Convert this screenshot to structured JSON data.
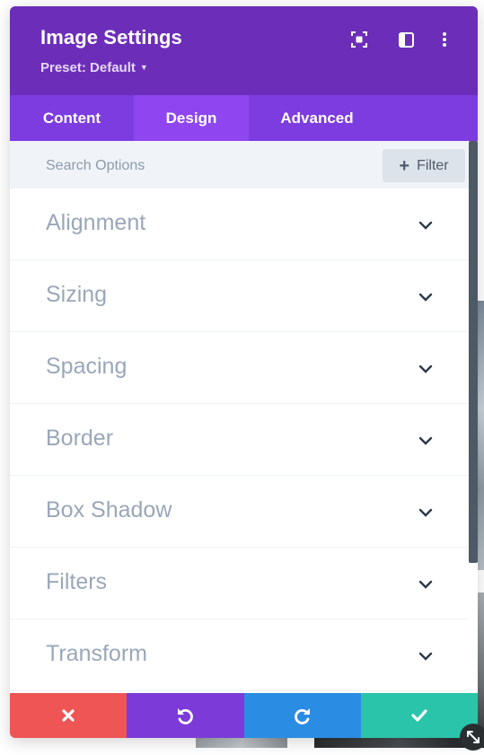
{
  "header": {
    "title": "Image Settings",
    "preset_label": "Preset: Default",
    "icons": [
      "focus-icon",
      "sidebar-layout-icon",
      "more-options-icon"
    ]
  },
  "tabs": [
    {
      "label": "Content",
      "active": false
    },
    {
      "label": "Design",
      "active": true
    },
    {
      "label": "Advanced",
      "active": false
    }
  ],
  "search": {
    "placeholder": "Search Options",
    "filter_label": "Filter"
  },
  "sections": [
    {
      "label": "Alignment"
    },
    {
      "label": "Sizing"
    },
    {
      "label": "Spacing"
    },
    {
      "label": "Border"
    },
    {
      "label": "Box Shadow"
    },
    {
      "label": "Filters"
    },
    {
      "label": "Transform"
    }
  ],
  "footer": {
    "buttons": [
      {
        "name": "cancel",
        "icon": "close-icon",
        "color": "#ef5555"
      },
      {
        "name": "undo",
        "icon": "undo-icon",
        "color": "#7c3bd8"
      },
      {
        "name": "redo",
        "icon": "redo-icon",
        "color": "#2b8ce4"
      },
      {
        "name": "save",
        "icon": "checkmark-icon",
        "color": "#29c4a9"
      }
    ]
  },
  "colors": {
    "header_bg": "#6c2eb9",
    "tabs_bg": "#7d3ce0",
    "active_tab_bg": "#8f45f0",
    "search_bg": "#f0f4f9"
  }
}
